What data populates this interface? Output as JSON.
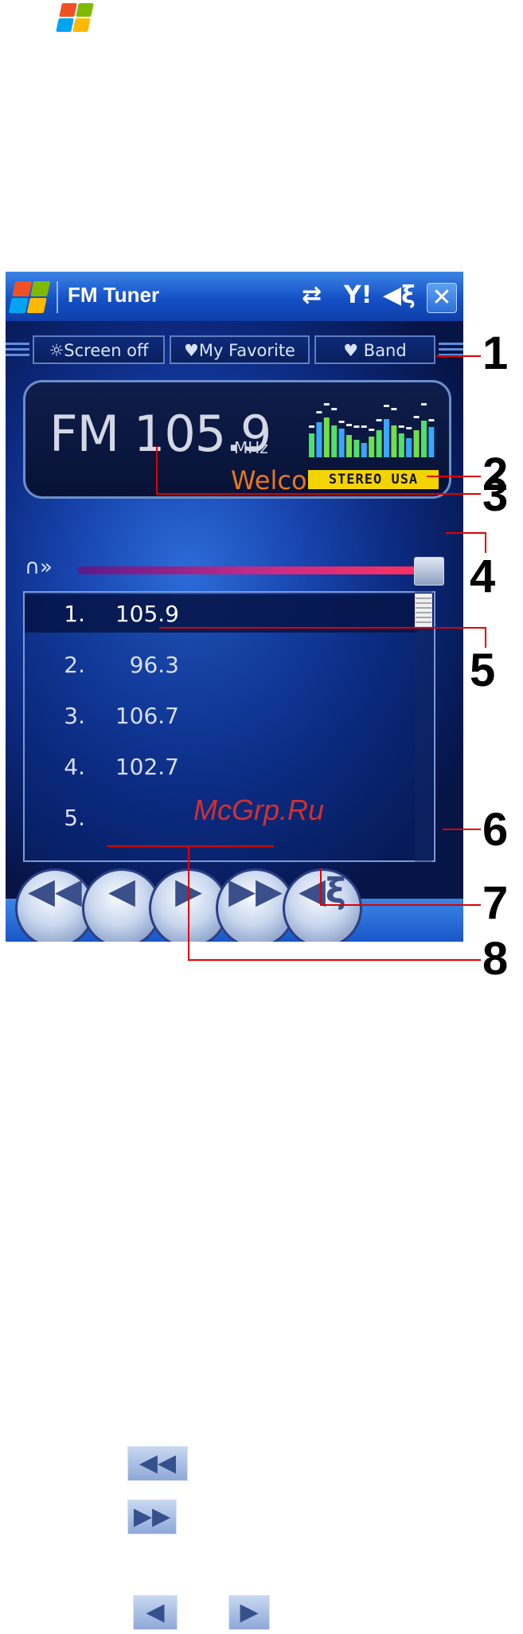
{
  "app": {
    "title": "FM Tuner",
    "close_label": "✕"
  },
  "toolbar": {
    "screen_off": "☼Screen off",
    "favorite": "♥My Favorite",
    "band": "♥ Band"
  },
  "display": {
    "band": "FM",
    "frequency": "105.9",
    "unit": "MHz",
    "rds_text": "Welcor",
    "status_badge": "STEREO USA"
  },
  "volume": {
    "level": 0.98
  },
  "presets": [
    {
      "num": "1.",
      "freq": "105.9",
      "selected": true
    },
    {
      "num": "2.",
      "freq": "96.3",
      "selected": false
    },
    {
      "num": "3.",
      "freq": "106.7",
      "selected": false
    },
    {
      "num": "4.",
      "freq": "102.7",
      "selected": false
    },
    {
      "num": "5.",
      "freq": "",
      "selected": false
    }
  ],
  "watermark": "McGrp.Ru",
  "callouts": [
    "1",
    "2",
    "3",
    "4",
    "5",
    "6",
    "7",
    "8"
  ],
  "colors": {
    "lcd_text": "#d4d8e6",
    "rds_text": "#e57720",
    "badge_bg": "#f4d400",
    "callout_line": "#e00000"
  },
  "icons": {
    "connectivity": "sync-arrows-icon",
    "signal": "signal-icon",
    "speaker": "speaker-icon",
    "keyboard": "keyboard-icon"
  }
}
